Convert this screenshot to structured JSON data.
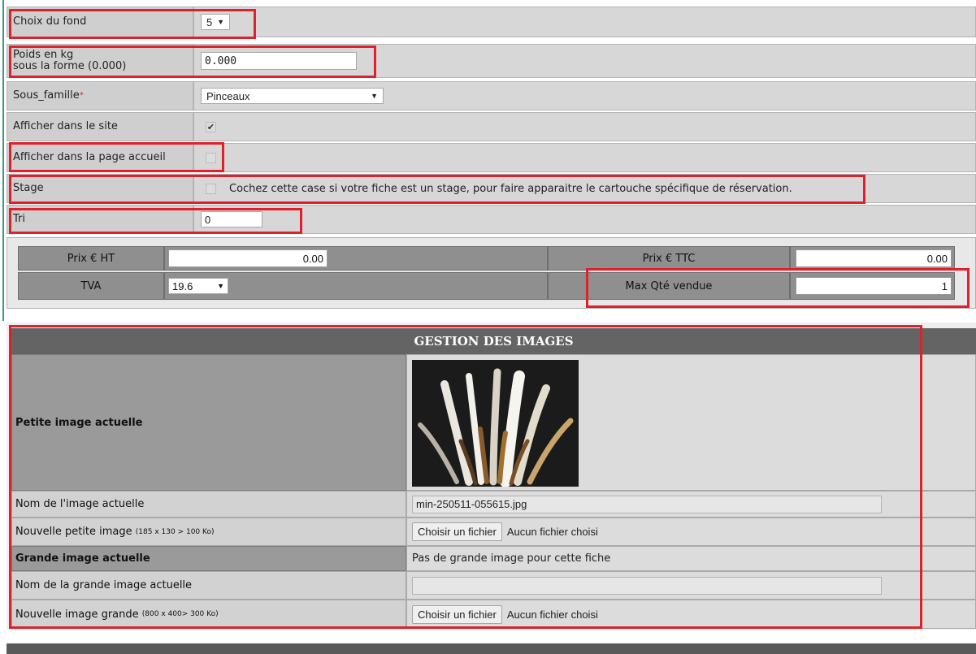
{
  "form": {
    "fond": {
      "label": "Choix du fond",
      "value": "5"
    },
    "poids": {
      "label_line1": "Poids en kg",
      "label_line2": "sous la forme (0.000)",
      "value": "0.000"
    },
    "sous_famille": {
      "label": "Sous_famille",
      "required_mark": "*",
      "value": "Pinceaux"
    },
    "afficher_site": {
      "label": "Afficher dans le site",
      "checked": true
    },
    "afficher_accueil": {
      "label": "Afficher dans la page accueil",
      "checked": false
    },
    "stage": {
      "label": "Stage",
      "note": "Cochez cette case si votre fiche est un stage, pour faire apparaitre le cartouche spécifique de réservation.",
      "checked": false
    },
    "tri": {
      "label": "Tri",
      "value": "0"
    }
  },
  "prices": {
    "prix_ht_label": "Prix € HT",
    "prix_ht_value": "0.00",
    "prix_ttc_label": "Prix € TTC",
    "prix_ttc_value": "0.00",
    "tva_label": "TVA",
    "tva_value": "19.6",
    "max_qte_label": "Max Qté vendue",
    "max_qte_value": "1"
  },
  "images": {
    "title": "GESTION DES IMAGES",
    "petite_label": "Petite image actuelle",
    "nom_label": "Nom de l'image actuelle",
    "nom_value": "min-250511-055615.jpg",
    "nouvelle_petite_label": "Nouvelle petite image",
    "nouvelle_petite_note": "(185 x 130 > 100 Ko)",
    "grande_label": "Grande image actuelle",
    "grande_value": "Pas de grande image pour cette fiche",
    "nom_grande_label": "Nom de la grande image actuelle",
    "nom_grande_value": "",
    "nouvelle_grande_label": "Nouvelle image grande",
    "nouvelle_grande_note": "(800 x 400> 300 Ko)",
    "file_button": "Choisir un fichier",
    "file_status": "Aucun fichier choisi"
  },
  "colors": {
    "highlight": "#e0202a",
    "header_bg": "#646464"
  }
}
